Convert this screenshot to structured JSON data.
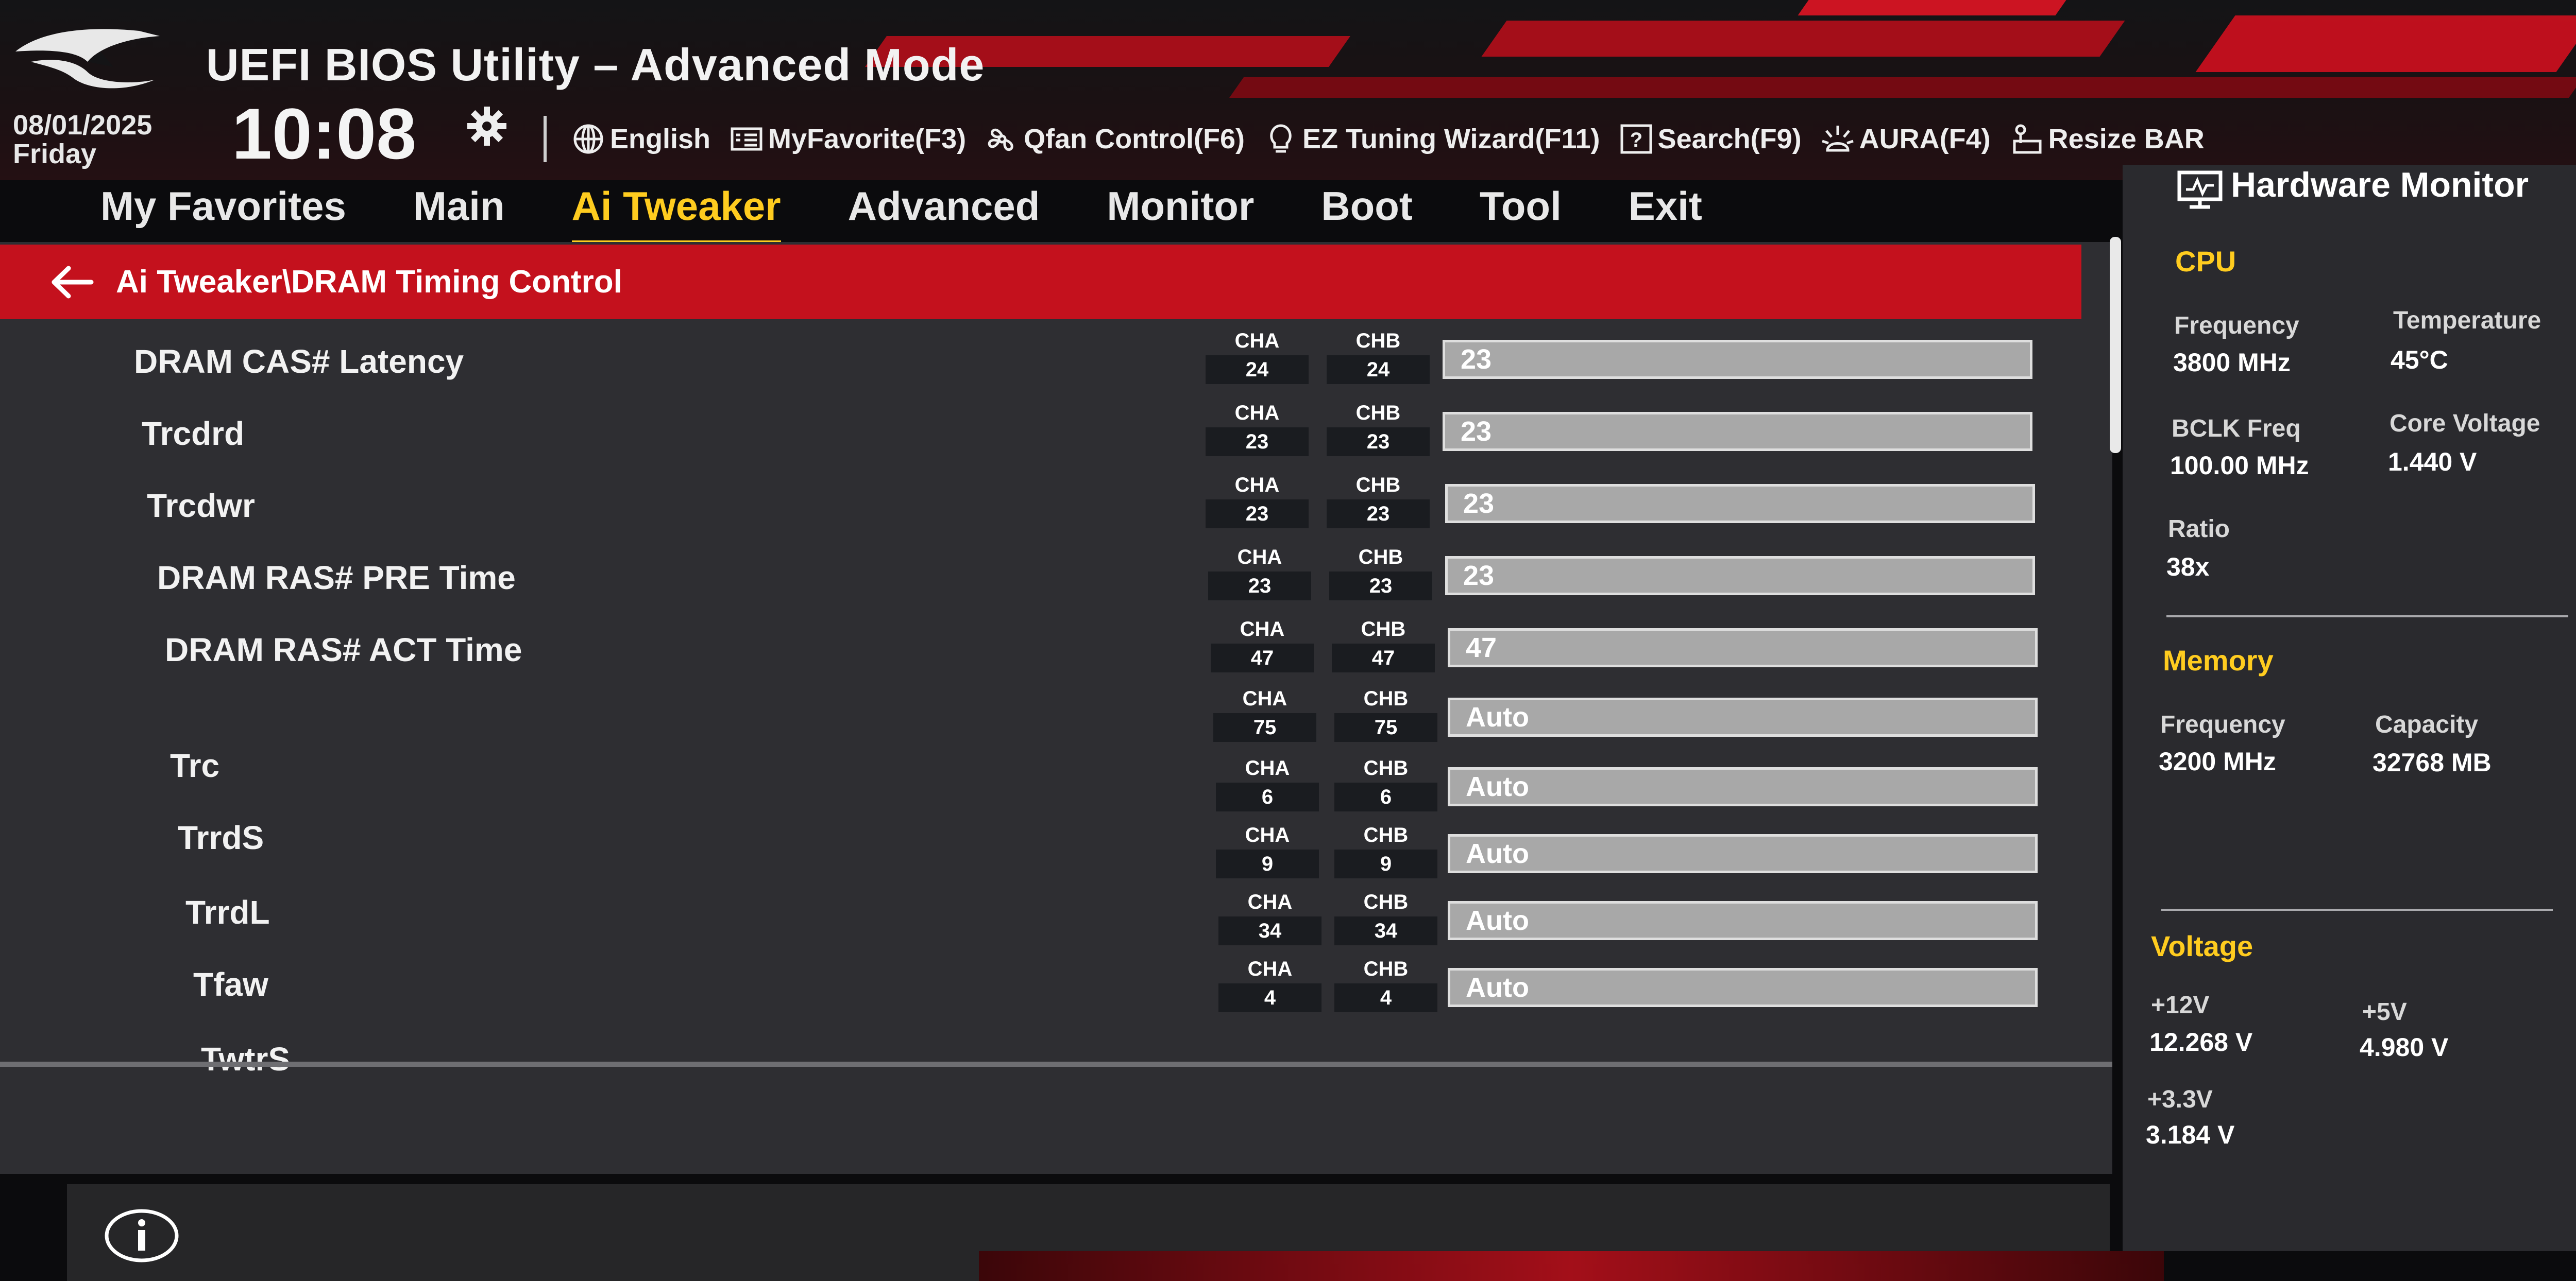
{
  "header": {
    "title": "UEFI BIOS Utility – Advanced Mode",
    "date": "08/01/2025",
    "day": "Friday",
    "time": "10:08",
    "toolbar": [
      {
        "icon": "globe-icon",
        "label": "English"
      },
      {
        "icon": "favorite-icon",
        "label": "MyFavorite(F3)"
      },
      {
        "icon": "fan-icon",
        "label": "Qfan Control(F6)"
      },
      {
        "icon": "bulb-icon",
        "label": "EZ Tuning Wizard(F11)"
      },
      {
        "icon": "help-icon",
        "label": "Search(F9)"
      },
      {
        "icon": "aura-icon",
        "label": "AURA(F4)"
      },
      {
        "icon": "resize-bar-icon",
        "label": "Resize BAR"
      }
    ]
  },
  "tabs": [
    {
      "label": "My Favorites",
      "active": false
    },
    {
      "label": "Main",
      "active": false
    },
    {
      "label": "Ai Tweaker",
      "active": true
    },
    {
      "label": "Advanced",
      "active": false
    },
    {
      "label": "Monitor",
      "active": false
    },
    {
      "label": "Boot",
      "active": false
    },
    {
      "label": "Tool",
      "active": false
    },
    {
      "label": "Exit",
      "active": false
    }
  ],
  "breadcrumb": "Ai Tweaker\\DRAM Timing Control",
  "channels": {
    "a": "CHA",
    "b": "CHB"
  },
  "rows": [
    {
      "label": "DRAM CAS# Latency",
      "cha": "24",
      "chb": "24",
      "value": "23"
    },
    {
      "label": "Trcdrd",
      "cha": "23",
      "chb": "23",
      "value": "23"
    },
    {
      "label": "Trcdwr",
      "cha": "23",
      "chb": "23",
      "value": "23"
    },
    {
      "label": "DRAM RAS# PRE Time",
      "cha": "23",
      "chb": "23",
      "value": "23"
    },
    {
      "label": "DRAM RAS# ACT Time",
      "cha": "47",
      "chb": "47",
      "value": "47"
    },
    {
      "label": "Trc",
      "cha": "75",
      "chb": "75",
      "value": "Auto"
    },
    {
      "label": "TrrdS",
      "cha": "6",
      "chb": "6",
      "value": "Auto"
    },
    {
      "label": "TrrdL",
      "cha": "9",
      "chb": "9",
      "value": "Auto"
    },
    {
      "label": "Tfaw",
      "cha": "34",
      "chb": "34",
      "value": "Auto"
    },
    {
      "label": "TwtrS",
      "cha": "4",
      "chb": "4",
      "value": "Auto"
    }
  ],
  "hardware_monitor": {
    "title": "Hardware Monitor",
    "cpu": {
      "section": "CPU",
      "frequency_label": "Frequency",
      "frequency": "3800 MHz",
      "temperature_label": "Temperature",
      "temperature": "45°C",
      "bclk_label": "BCLK Freq",
      "bclk": "100.00 MHz",
      "core_voltage_label": "Core Voltage",
      "core_voltage": "1.440 V",
      "ratio_label": "Ratio",
      "ratio": "38x"
    },
    "memory": {
      "section": "Memory",
      "frequency_label": "Frequency",
      "frequency": "3200 MHz",
      "capacity_label": "Capacity",
      "capacity": "32768 MB"
    },
    "voltage": {
      "section": "Voltage",
      "v12_label": "+12V",
      "v12": "12.268 V",
      "v5_label": "+5V",
      "v5": "4.980 V",
      "v33_label": "+3.3V",
      "v33": "3.184 V"
    }
  },
  "colors": {
    "accent": "#ffcc1f",
    "brand_red": "#c4111d",
    "panel": "#2e2e32"
  }
}
